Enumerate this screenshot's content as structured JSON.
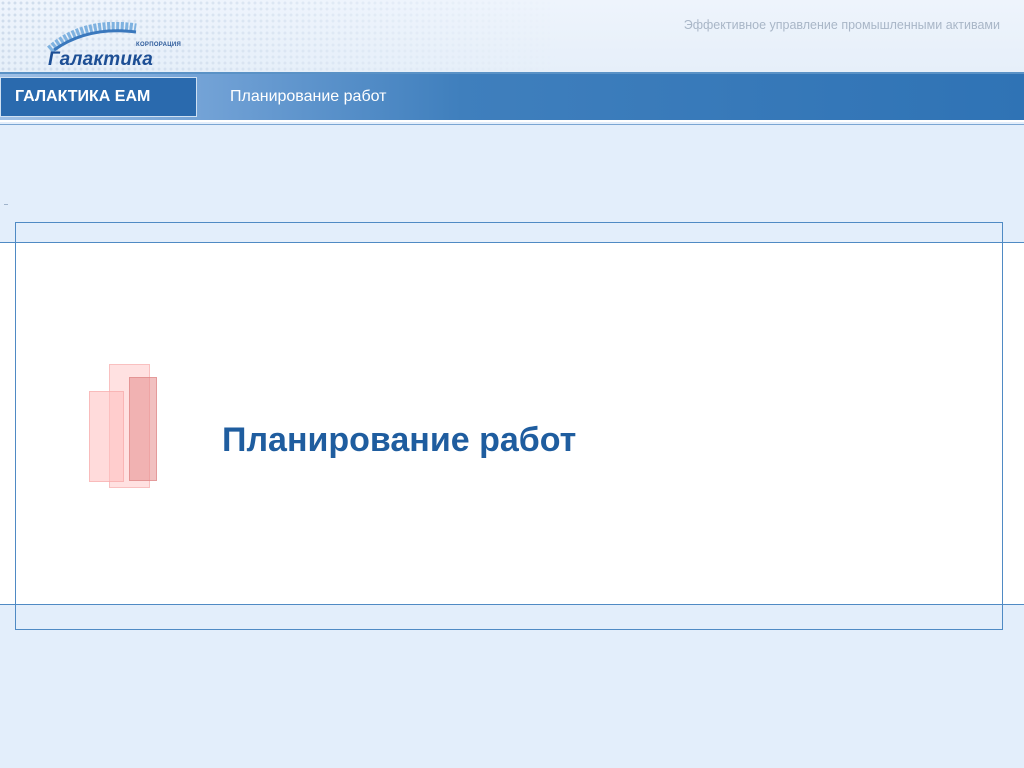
{
  "header": {
    "logo_corp_text": "КОРПОРАЦИЯ",
    "logo_name": "Галактика",
    "tagline": "Эффективное управление промышленными активами"
  },
  "title_bar": {
    "brand": "ГАЛАКТИКА EAM",
    "section": "Планирование работ"
  },
  "slide": {
    "title": "Планирование работ"
  },
  "colors": {
    "background": "#e3eefb",
    "bar_blue": "#2f73b5",
    "title_blue": "#1f5d9f",
    "accent_pink": "#f2b3b3"
  }
}
